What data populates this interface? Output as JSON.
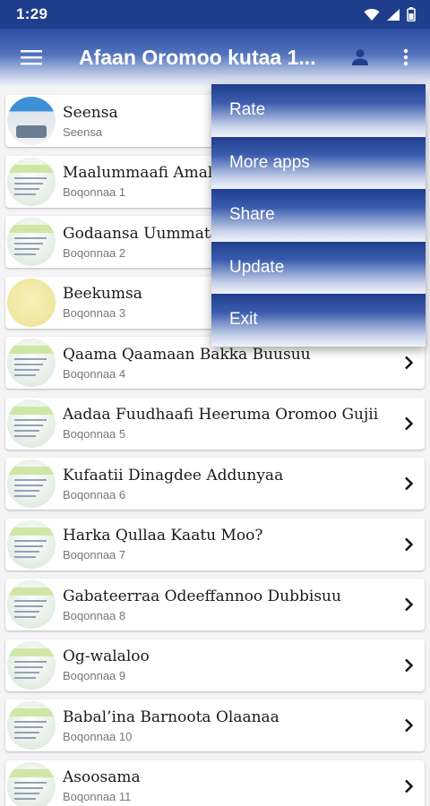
{
  "status_bar": {
    "time": "1:29"
  },
  "app_bar": {
    "title": "Afaan Oromoo kutaa 1..."
  },
  "lessons": [
    {
      "title": "Seensa",
      "subtitle": "Seensa",
      "thumb": "photo"
    },
    {
      "title": "Maalummaafi Amal",
      "subtitle": "Boqonnaa 1",
      "thumb": "doc"
    },
    {
      "title": "Godaansa Uummata",
      "subtitle": "Boqonnaa 2",
      "thumb": "doc"
    },
    {
      "title": "Beekumsa",
      "subtitle": "Boqonnaa 3",
      "thumb": "yellow"
    },
    {
      "title": "Qaama Qaamaan Bakka Buusuu",
      "subtitle": "Boqonnaa 4",
      "thumb": "doc"
    },
    {
      "title": "Aadaa Fuudhaafi Heeruma Oromoo Gujii",
      "subtitle": "Boqonnaa 5",
      "thumb": "doc"
    },
    {
      "title": "Kufaatii Dinagdee Addunyaa",
      "subtitle": "Boqonnaa 6",
      "thumb": "doc"
    },
    {
      "title": "Harka Qullaa Kaatu Moo?",
      "subtitle": "Boqonnaa 7",
      "thumb": "doc"
    },
    {
      "title": "Gabateerraa Odeeffannoo Dubbisuu",
      "subtitle": "Boqonnaa 8",
      "thumb": "doc"
    },
    {
      "title": "Og-walaloo",
      "subtitle": "Boqonnaa 9",
      "thumb": "doc"
    },
    {
      "title": "Babal’ina Barnoota Olaanaa",
      "subtitle": "Boqonnaa 10",
      "thumb": "doc"
    },
    {
      "title": "Asoosama",
      "subtitle": "Boqonnaa 11",
      "thumb": "doc"
    }
  ],
  "overflow_menu": {
    "items": [
      "Rate",
      "More apps",
      "Share",
      "Update",
      "Exit"
    ]
  },
  "colors": {
    "primary": "#1f3f8c",
    "menu_top": "#1f3e8e"
  },
  "icons": {
    "menu": "hamburger-icon",
    "account": "person-icon",
    "more": "more-vert-icon",
    "chevron": "chevron-right-icon"
  }
}
